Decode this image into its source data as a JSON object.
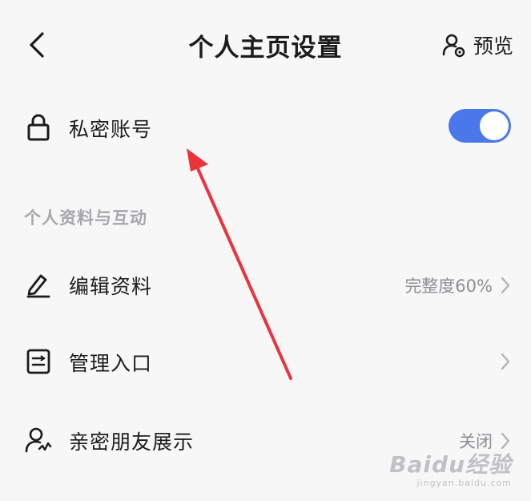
{
  "header": {
    "title": "个人主页设置",
    "preview_label": "预览",
    "back_icon": "chevron-left-icon",
    "preview_icon": "user-preview-icon"
  },
  "private_account": {
    "label": "私密账号",
    "icon": "lock-icon",
    "enabled": true
  },
  "section": {
    "title": "个人资料与互动"
  },
  "items": [
    {
      "label": "编辑资料",
      "value": "完整度60%",
      "icon": "edit-pencil-icon"
    },
    {
      "label": "管理入口",
      "value": "",
      "icon": "entry-list-icon"
    },
    {
      "label": "亲密朋友展示",
      "value": "关闭",
      "icon": "close-friend-icon"
    }
  ],
  "colors": {
    "accent": "#4a78ea",
    "annotation": "#e8343a",
    "background": "#f7f7f8"
  },
  "watermark": {
    "brand": "Baidu经验",
    "url": "jingyan.baidu.com"
  }
}
